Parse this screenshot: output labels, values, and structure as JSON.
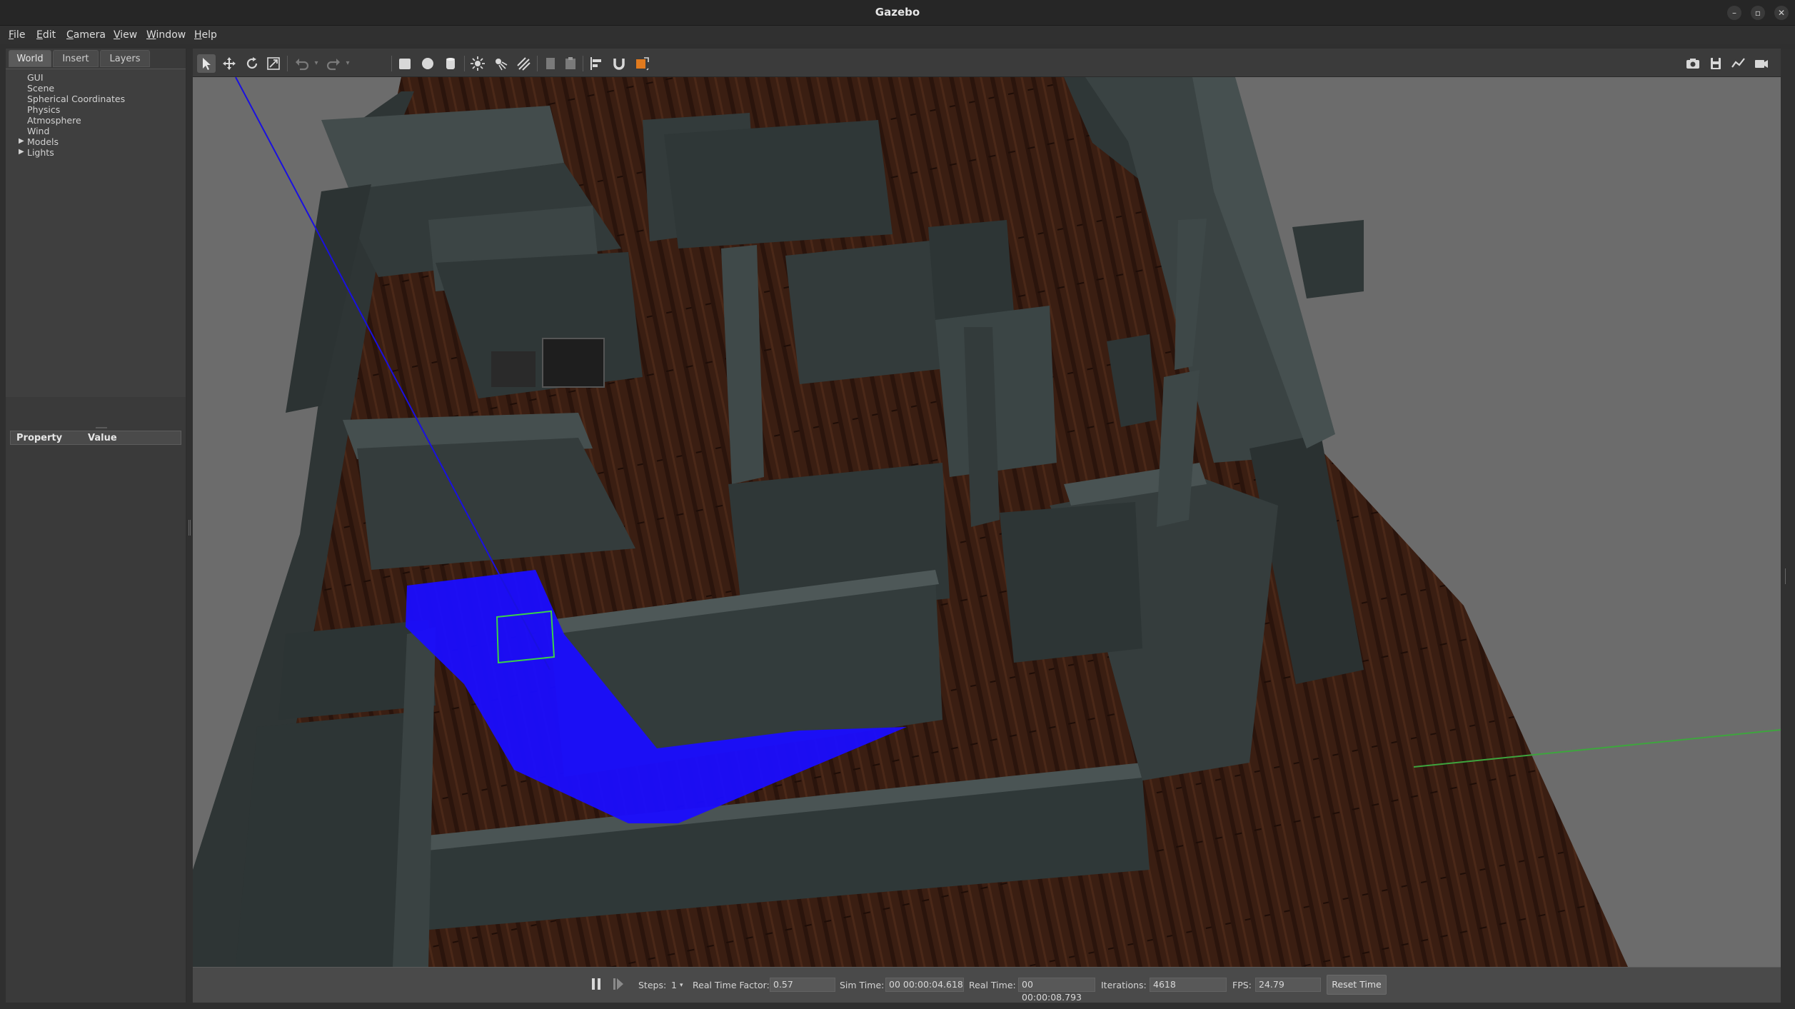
{
  "window": {
    "title": "Gazebo"
  },
  "menu": [
    {
      "label": "File",
      "ul": "F",
      "rest": "ile"
    },
    {
      "label": "Edit",
      "ul": "E",
      "rest": "dit"
    },
    {
      "label": "Camera",
      "ul": "C",
      "rest": "amera"
    },
    {
      "label": "View",
      "ul": "V",
      "rest": "iew"
    },
    {
      "label": "Window",
      "ul": "W",
      "rest": "indow"
    },
    {
      "label": "Help",
      "ul": "H",
      "rest": "elp"
    }
  ],
  "left_panel": {
    "tabs": [
      "World",
      "Insert",
      "Layers"
    ],
    "active_tab": "World",
    "tree": [
      "GUI",
      "Scene",
      "Spherical Coordinates",
      "Physics",
      "Atmosphere",
      "Wind",
      "Models",
      "Lights"
    ],
    "property_header": {
      "property": "Property",
      "value": "Value"
    }
  },
  "toolbar": {
    "icons": [
      "select-arrow-icon",
      "translate-icon",
      "rotate-icon",
      "scale-icon",
      "undo-icon",
      "redo-icon",
      "box-icon",
      "sphere-icon",
      "cylinder-icon",
      "point-light-icon",
      "spot-light-icon",
      "directional-light-icon",
      "copy-icon",
      "paste-icon",
      "align-icon",
      "snap-icon",
      "change-view-icon",
      "screenshot-icon",
      "log-icon",
      "plot-icon",
      "video-record-icon"
    ],
    "selected": "select-arrow-icon"
  },
  "status_bar": {
    "steps_label": "Steps:",
    "steps_value": "1",
    "rtf_label": "Real Time Factor:",
    "rtf_value": "0.57",
    "sim_time_label": "Sim Time:",
    "sim_time_value": "00 00:00:04.618",
    "real_time_label": "Real Time:",
    "real_time_value": "00 00:00:08.793",
    "iterations_label": "Iterations:",
    "iterations_value": "4618",
    "fps_label": "FPS:",
    "fps_value": "24.79",
    "reset_label": "Reset Time"
  },
  "colors": {
    "background": "#6b6b6b",
    "floor": "#3b1f14",
    "walls": "#343c3c",
    "laser": "#1a0dff"
  }
}
